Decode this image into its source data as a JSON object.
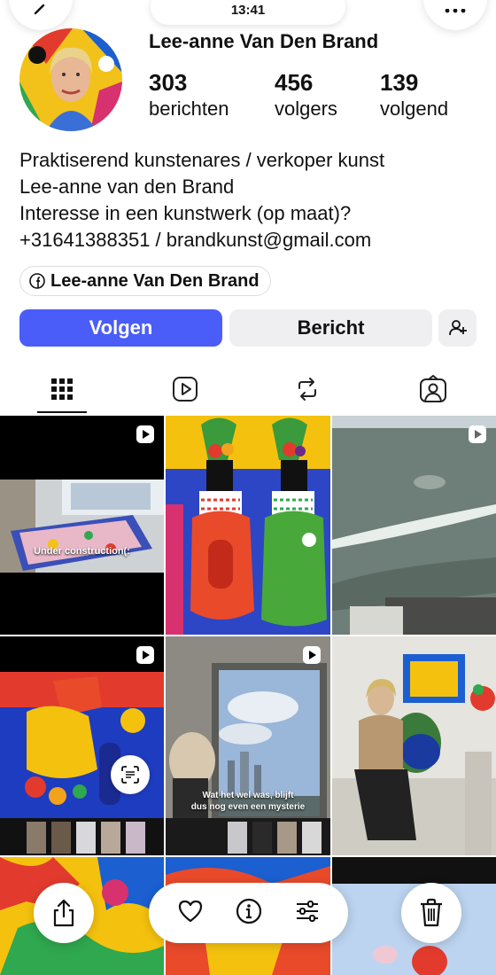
{
  "status_bar": {
    "time": "13:41"
  },
  "profile": {
    "name": "Lee-anne Van Den Brand",
    "stats": {
      "posts": {
        "count": "303",
        "label": "berichten"
      },
      "followers": {
        "count": "456",
        "label": "volgers"
      },
      "following": {
        "count": "139",
        "label": "volgend"
      }
    },
    "bio": [
      "Praktiserend kunstenares / verkoper kunst",
      "Lee-anne van den Brand",
      "Interesse in een kunstwerk (op maat)?",
      "+31641388351 / brandkunst@gmail.com"
    ],
    "facebook_link": "Lee-anne Van Den Brand"
  },
  "actions": {
    "follow": "Volgen",
    "message": "Bericht"
  },
  "tabs": [
    "grid-icon",
    "reels-icon",
    "reposts-icon",
    "tagged-icon"
  ],
  "posts": {
    "post1_caption": "Under construction(:",
    "post5_caption_line1": "Wat het wel was, blijft",
    "post5_caption_line2": "dus nog even een mysterie"
  },
  "colors": {
    "accent": "#4a5df9",
    "secondary_button": "#efeff1"
  }
}
